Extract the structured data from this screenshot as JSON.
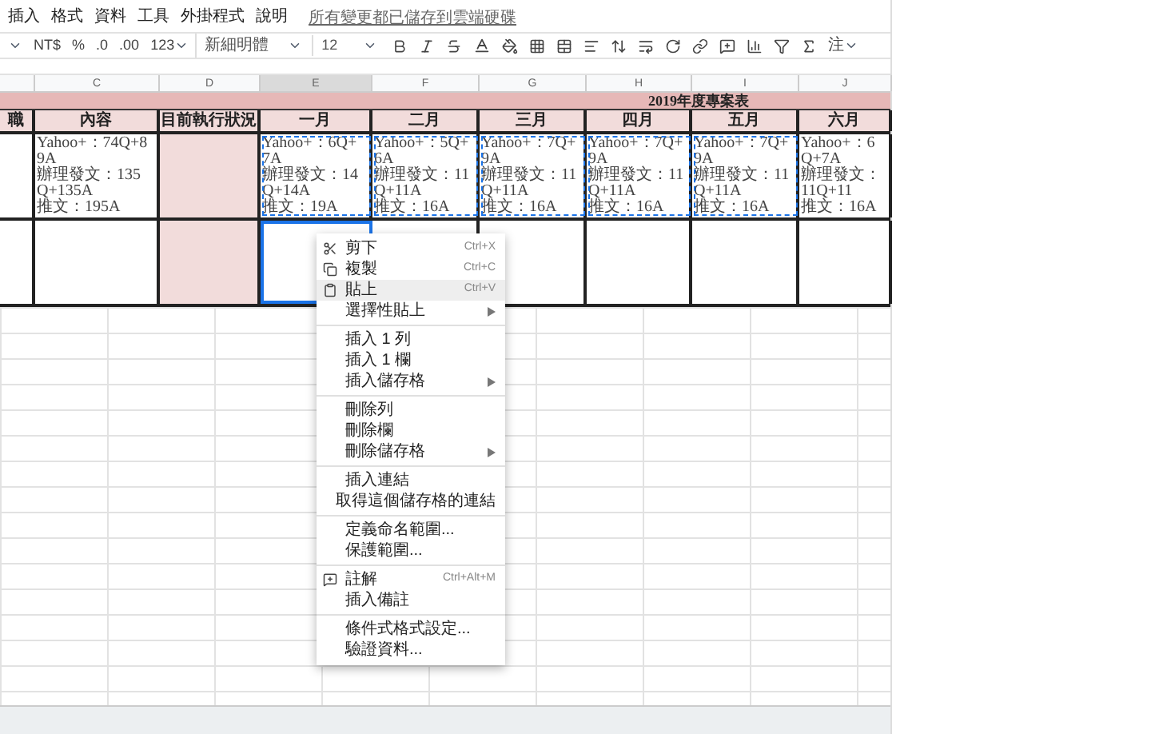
{
  "menu": {
    "items": [
      "插入",
      "格式",
      "資料",
      "工具",
      "外掛程式",
      "說明"
    ],
    "save_status": "所有變更都已儲存到雲端硬碟"
  },
  "toolbar": {
    "currency": "NT$",
    "percent": "%",
    "decrease_decimals": ".0",
    "increase_decimals": ".00",
    "number_format": "123",
    "font": "新細明體",
    "font_size": "12",
    "input_tools": "注"
  },
  "columns": [
    {
      "selected": false
    },
    {
      "label": "C",
      "selected": false
    },
    {
      "label": "D",
      "selected": false
    },
    {
      "label": "E",
      "selected": true
    },
    {
      "label": "F",
      "selected": false
    },
    {
      "label": "G",
      "selected": false
    },
    {
      "label": "H",
      "selected": false
    },
    {
      "label": "I",
      "selected": false
    },
    {
      "label": "J",
      "selected": false
    }
  ],
  "band_title": "2019年度專案表",
  "headers": [
    "職",
    "內容",
    "目前執行狀況",
    "一月",
    "二月",
    "三月",
    "四月",
    "五月",
    "六月"
  ],
  "rows": [
    {
      "cells": [
        {
          "shaded": false,
          "copied": false
        },
        {
          "lines": [
            "Yahoo+：74Q+89A",
            "辦理發文：135Q+135A",
            "推文：195A"
          ],
          "shaded": false,
          "copied": false
        },
        {
          "shaded": true,
          "copied": false
        },
        {
          "lines": [
            "Yahoo+：6Q+7A",
            "辦理發文：14Q+14A",
            "推文：19A"
          ],
          "shaded": false,
          "copied": true
        },
        {
          "lines": [
            "Yahoo+：5Q+6A",
            "辦理發文：11Q+11A",
            "推文：16A"
          ],
          "shaded": false,
          "copied": true
        },
        {
          "lines": [
            "Yahoo+：7Q+9A",
            "辦理發文：11Q+11A",
            "推文：16A"
          ],
          "shaded": false,
          "copied": true
        },
        {
          "lines": [
            "Yahoo+：7Q+9A",
            "辦理發文：11Q+11A",
            "推文：16A"
          ],
          "shaded": false,
          "copied": true
        },
        {
          "lines": [
            "Yahoo+：7Q+9A",
            "辦理發文：11Q+11A",
            "推文：16A"
          ],
          "shaded": false,
          "copied": true
        },
        {
          "lines": [
            "Yahoo+：6Q+7A",
            "辦理發文：11Q+11",
            "推文：16A"
          ],
          "shaded": false,
          "copied": false
        }
      ]
    },
    {
      "cells": [
        {
          "shaded": false,
          "selected": false
        },
        {
          "shaded": false,
          "selected": false
        },
        {
          "shaded": true,
          "selected": false
        },
        {
          "shaded": false,
          "selected": true
        },
        {
          "shaded": false,
          "selected": false
        },
        {
          "shaded": false,
          "selected": false
        },
        {
          "shaded": false,
          "selected": false
        },
        {
          "shaded": false,
          "selected": false
        },
        {
          "shaded": false,
          "selected": false
        }
      ]
    }
  ],
  "context_menu": [
    {
      "kind": "item",
      "label": "剪下",
      "shortcut": "Ctrl+X",
      "selected": false
    },
    {
      "kind": "item",
      "label": "複製",
      "shortcut": "Ctrl+C",
      "selected": false
    },
    {
      "kind": "item",
      "label": "貼上",
      "shortcut": "Ctrl+V",
      "selected": true
    },
    {
      "kind": "submenu",
      "label": "選擇性貼上",
      "selected": false
    },
    {
      "kind": "separator"
    },
    {
      "kind": "item",
      "label": "插入 1 列",
      "selected": false
    },
    {
      "kind": "item",
      "label": "插入 1 欄",
      "selected": false
    },
    {
      "kind": "submenu",
      "label": "插入儲存格",
      "selected": false
    },
    {
      "kind": "separator"
    },
    {
      "kind": "item",
      "label": "刪除列",
      "selected": false
    },
    {
      "kind": "item",
      "label": "刪除欄",
      "selected": false
    },
    {
      "kind": "submenu",
      "label": "刪除儲存格",
      "selected": false
    },
    {
      "kind": "separator"
    },
    {
      "kind": "item",
      "label": "插入連結",
      "selected": false
    },
    {
      "kind": "item",
      "label": "取得這個儲存格的連結",
      "selected": false
    },
    {
      "kind": "separator"
    },
    {
      "kind": "item",
      "label": "定義命名範圍...",
      "selected": false
    },
    {
      "kind": "item",
      "label": "保護範圍...",
      "selected": false
    },
    {
      "kind": "separator"
    },
    {
      "kind": "item",
      "label": "註解",
      "shortcut": "Ctrl+Alt+M",
      "selected": false
    },
    {
      "kind": "item",
      "label": "插入備註",
      "selected": false
    },
    {
      "kind": "separator"
    },
    {
      "kind": "item",
      "label": "條件式格式設定...",
      "selected": false
    },
    {
      "kind": "item",
      "label": "驗證資料...",
      "selected": false
    }
  ]
}
